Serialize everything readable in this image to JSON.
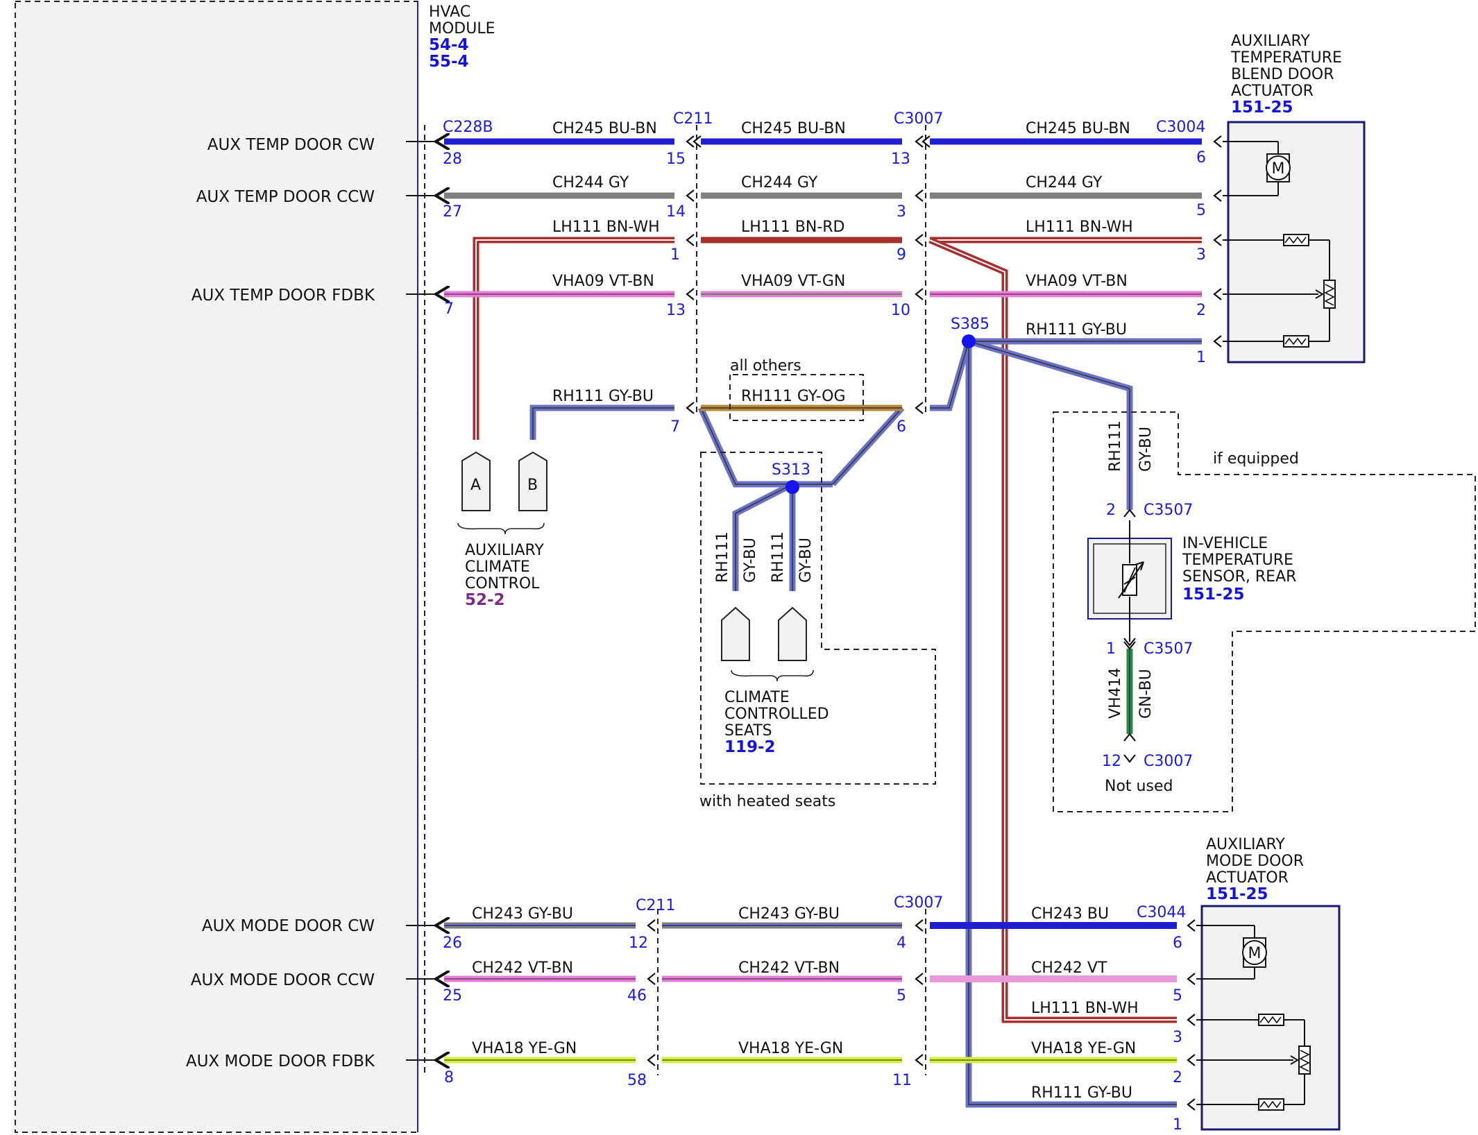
{
  "module": {
    "title_lines": [
      "HVAC",
      "MODULE"
    ],
    "refs": [
      "54-4",
      "55-4"
    ]
  },
  "signals": {
    "aux_temp_cw": "AUX TEMP DOOR CW",
    "aux_temp_ccw": "AUX TEMP DOOR CCW",
    "aux_temp_fdbk": "AUX TEMP DOOR FDBK",
    "aux_mode_cw": "AUX MODE DOOR CW",
    "aux_mode_ccw": "AUX MODE DOOR CCW",
    "aux_mode_fdbk": "AUX MODE DOOR FDBK"
  },
  "connectors": {
    "c228b": "C228B",
    "c211_top": "C211",
    "c3007_top": "C3007",
    "c3004": "C3004",
    "c211_bottom": "C211",
    "c3007_bottom": "C3007",
    "c3044": "C3044",
    "c3507_top": "C3507",
    "c3507_bottom": "C3507",
    "c3007_notused": "C3007"
  },
  "splices": {
    "s385": "S385",
    "s313": "S313"
  },
  "components": {
    "temp_actuator": {
      "lines": [
        "AUXILIARY",
        "TEMPERATURE",
        "BLEND DOOR",
        "ACTUATOR"
      ],
      "ref": "151-25"
    },
    "mode_actuator": {
      "lines": [
        "AUXILIARY",
        "MODE DOOR",
        "ACTUATOR"
      ],
      "ref": "151-25"
    },
    "aux_climate": {
      "lines": [
        "AUXILIARY",
        "CLIMATE",
        "CONTROL"
      ],
      "ref": "52-2",
      "pin_a": "A",
      "pin_b": "B"
    },
    "seats": {
      "lines": [
        "CLIMATE",
        "CONTROLLED",
        "SEATS"
      ],
      "ref": "119-2"
    },
    "sensor": {
      "lines": [
        "IN-VEHICLE",
        "TEMPERATURE",
        "SENSOR, REAR"
      ],
      "ref": "151-25"
    },
    "motor_symbol": "M"
  },
  "notes": {
    "all_others": "all others",
    "with_heated_seats": "with heated seats",
    "if_equipped": "if equipped",
    "not_used": "Not used"
  },
  "wire_labels": {
    "w1a": "CH245   BU-BN",
    "w1b": "CH245   BU-BN",
    "w1c": "CH245   BU-BN",
    "w2a": "CH244   GY",
    "w2b": "CH244   GY",
    "w2c": "CH244   GY",
    "w3a": "LH111   BN-WH",
    "w3b": "LH111   BN-RD",
    "w3c": "LH111   BN-WH",
    "w4a": "VHA09   VT-BN",
    "w4b": "VHA09   VT-GN",
    "w4c": "VHA09   VT-BN",
    "w5c": "RH111   GY-BU",
    "w6a": "RH111   GY-BU",
    "w6b": "RH111   GY-OG",
    "v_sensor_top_1": "RH111",
    "v_sensor_top_2": "GY-BU",
    "v_sensor_bot_1": "VH414",
    "v_sensor_bot_2": "GN-BU",
    "v_seat1_1": "RH111",
    "v_seat1_2": "GY-BU",
    "v_seat2_1": "RH111",
    "v_seat2_2": "GY-BU",
    "m1a": "CH243   GY-BU",
    "m1b": "CH243   GY-BU",
    "m1c": "CH243   BU",
    "m2a": "CH242   VT-BN",
    "m2b": "CH242   VT-BN",
    "m2c": "CH242   VT",
    "m3c": "LH111   BN-WH",
    "m4a": "VHA18   YE-GN",
    "m4b": "VHA18   YE-GN",
    "m4c": "VHA18   YE-GN",
    "m5c": "RH111   GY-BU"
  },
  "pins": {
    "p28": "28",
    "p15": "15",
    "p13a": "13",
    "p6a": "6",
    "p27": "27",
    "p14": "14",
    "p3a": "3",
    "p5a": "5",
    "p1a": "1",
    "p9": "9",
    "p3b": "3",
    "p7a": "7",
    "p13b": "13",
    "p10": "10",
    "p2a": "2",
    "p1b": "1",
    "p7b": "7",
    "p6b": "6",
    "p2s": "2",
    "p1s": "1",
    "p12s": "12",
    "p26": "26",
    "p12": "12",
    "p4": "4",
    "p6c": "6",
    "p25": "25",
    "p46": "46",
    "p5b": "5",
    "p5c": "5",
    "p3c": "3",
    "p8": "8",
    "p58": "58",
    "p11": "11",
    "p2b": "2",
    "p1c": "1"
  },
  "colors": {
    "blue": "#1f1fd1",
    "gray": "#7f7f7f",
    "brown_red": "#a5302e",
    "violet": "#e47fd6",
    "gray_blue": "#6a72c8",
    "orange": "#b88a3a",
    "yellow_green": "#d7ee3a",
    "green": "#2e8b3b",
    "pin_text": "#1a1adf"
  }
}
